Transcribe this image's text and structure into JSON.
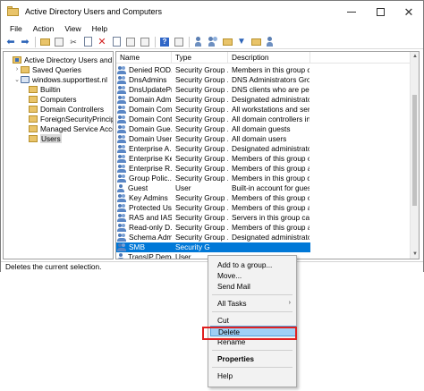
{
  "window": {
    "title": "Active Directory Users and Computers",
    "minimize": "—",
    "maximize": "☐",
    "close": "✕"
  },
  "menu": [
    "File",
    "Action",
    "View",
    "Help"
  ],
  "toolbar": {
    "icons": [
      "back-icon",
      "forward-icon",
      "up-folder-icon",
      "properties-pane-icon",
      "cut-icon",
      "copy-icon",
      "delete-icon",
      "properties-icon",
      "export-icon",
      "refresh-icon",
      "help-icon",
      "console-icon",
      "new-user-icon",
      "new-group-icon",
      "new-ou-icon",
      "filter-icon",
      "find-icon",
      "add-to-group-icon"
    ]
  },
  "tree": [
    {
      "label": "Active Directory Users and Comp",
      "icon": "ad",
      "arrow": "",
      "indent": 0
    },
    {
      "label": "Saved Queries",
      "icon": "folder",
      "arrow": ">",
      "indent": 1
    },
    {
      "label": "windows.supporttest.nl",
      "icon": "domain",
      "arrow": "v",
      "indent": 1
    },
    {
      "label": "Builtin",
      "icon": "folder",
      "arrow": "",
      "indent": 2
    },
    {
      "label": "Computers",
      "icon": "folder",
      "arrow": "",
      "indent": 2
    },
    {
      "label": "Domain Controllers",
      "icon": "folder",
      "arrow": "",
      "indent": 2
    },
    {
      "label": "ForeignSecurityPrincipals",
      "icon": "folder",
      "arrow": "",
      "indent": 2
    },
    {
      "label": "Managed Service Accoun",
      "icon": "folder",
      "arrow": "",
      "indent": 2
    },
    {
      "label": "Users",
      "icon": "folder",
      "arrow": "",
      "indent": 2,
      "selected": true
    }
  ],
  "list": {
    "columns": [
      "Name",
      "Type",
      "Description"
    ],
    "rows": [
      {
        "name": "Denied ROD...",
        "type": "Security Group ...",
        "desc": "Members in this group c",
        "icon": "group"
      },
      {
        "name": "DnsAdmins",
        "type": "Security Group ...",
        "desc": "DNS Administrators Group",
        "icon": "group"
      },
      {
        "name": "DnsUpdatePr...",
        "type": "Security Group ...",
        "desc": "DNS clients who are per",
        "icon": "group"
      },
      {
        "name": "Domain Adm...",
        "type": "Security Group ...",
        "desc": "Designated administrato",
        "icon": "group"
      },
      {
        "name": "Domain Com...",
        "type": "Security Group ...",
        "desc": "All workstations and serv",
        "icon": "group"
      },
      {
        "name": "Domain Cont...",
        "type": "Security Group ...",
        "desc": "All domain controllers in",
        "icon": "group"
      },
      {
        "name": "Domain Gue...",
        "type": "Security Group ...",
        "desc": "All domain guests",
        "icon": "group"
      },
      {
        "name": "Domain Users",
        "type": "Security Group ...",
        "desc": "All domain users",
        "icon": "group"
      },
      {
        "name": "Enterprise A...",
        "type": "Security Group ...",
        "desc": "Designated administrato",
        "icon": "group"
      },
      {
        "name": "Enterprise Ke...",
        "type": "Security Group ...",
        "desc": "Members of this group c",
        "icon": "group"
      },
      {
        "name": "Enterprise R...",
        "type": "Security Group ...",
        "desc": "Members of this group a",
        "icon": "group"
      },
      {
        "name": "Group Polic...",
        "type": "Security Group ...",
        "desc": "Members in this group c",
        "icon": "group"
      },
      {
        "name": "Guest",
        "type": "User",
        "desc": "Built-in account for gues",
        "icon": "user"
      },
      {
        "name": "Key Admins",
        "type": "Security Group ...",
        "desc": "Members of this group c",
        "icon": "group"
      },
      {
        "name": "Protected Us...",
        "type": "Security Group ...",
        "desc": "Members of this group a",
        "icon": "group"
      },
      {
        "name": "RAS and IAS ...",
        "type": "Security Group ...",
        "desc": "Servers in this group can",
        "icon": "group"
      },
      {
        "name": "Read-only D...",
        "type": "Security Group ...",
        "desc": "Members of this group a",
        "icon": "group"
      },
      {
        "name": "Schema Adm...",
        "type": "Security Group ...",
        "desc": "Designated administrato",
        "icon": "group"
      },
      {
        "name": "SMB",
        "type": "Security G",
        "desc": "",
        "icon": "group",
        "selected": true
      },
      {
        "name": "TransIP Demo",
        "type": "User",
        "desc": "",
        "icon": "user"
      }
    ]
  },
  "status": "Deletes the current selection.",
  "context_menu": {
    "items": [
      {
        "label": "Add to a group...",
        "sep_after": false
      },
      {
        "label": "Move...",
        "sep_after": false
      },
      {
        "label": "Send Mail",
        "sep_after": true
      },
      {
        "label": "All Tasks",
        "submenu": true,
        "sep_after": true
      },
      {
        "label": "Cut",
        "sep_after": false
      },
      {
        "label": "Delete",
        "highlighted": true,
        "sep_after": false
      },
      {
        "label": "Rename",
        "sep_after": true
      },
      {
        "label": "Properties",
        "bold": true,
        "sep_after": true
      },
      {
        "label": "Help",
        "sep_after": false
      }
    ],
    "submenu_arrow": "›"
  },
  "colors": {
    "selection": "#0078d7",
    "menu_highlight": "#9fd0f5",
    "annotation_box": "#e02020"
  }
}
